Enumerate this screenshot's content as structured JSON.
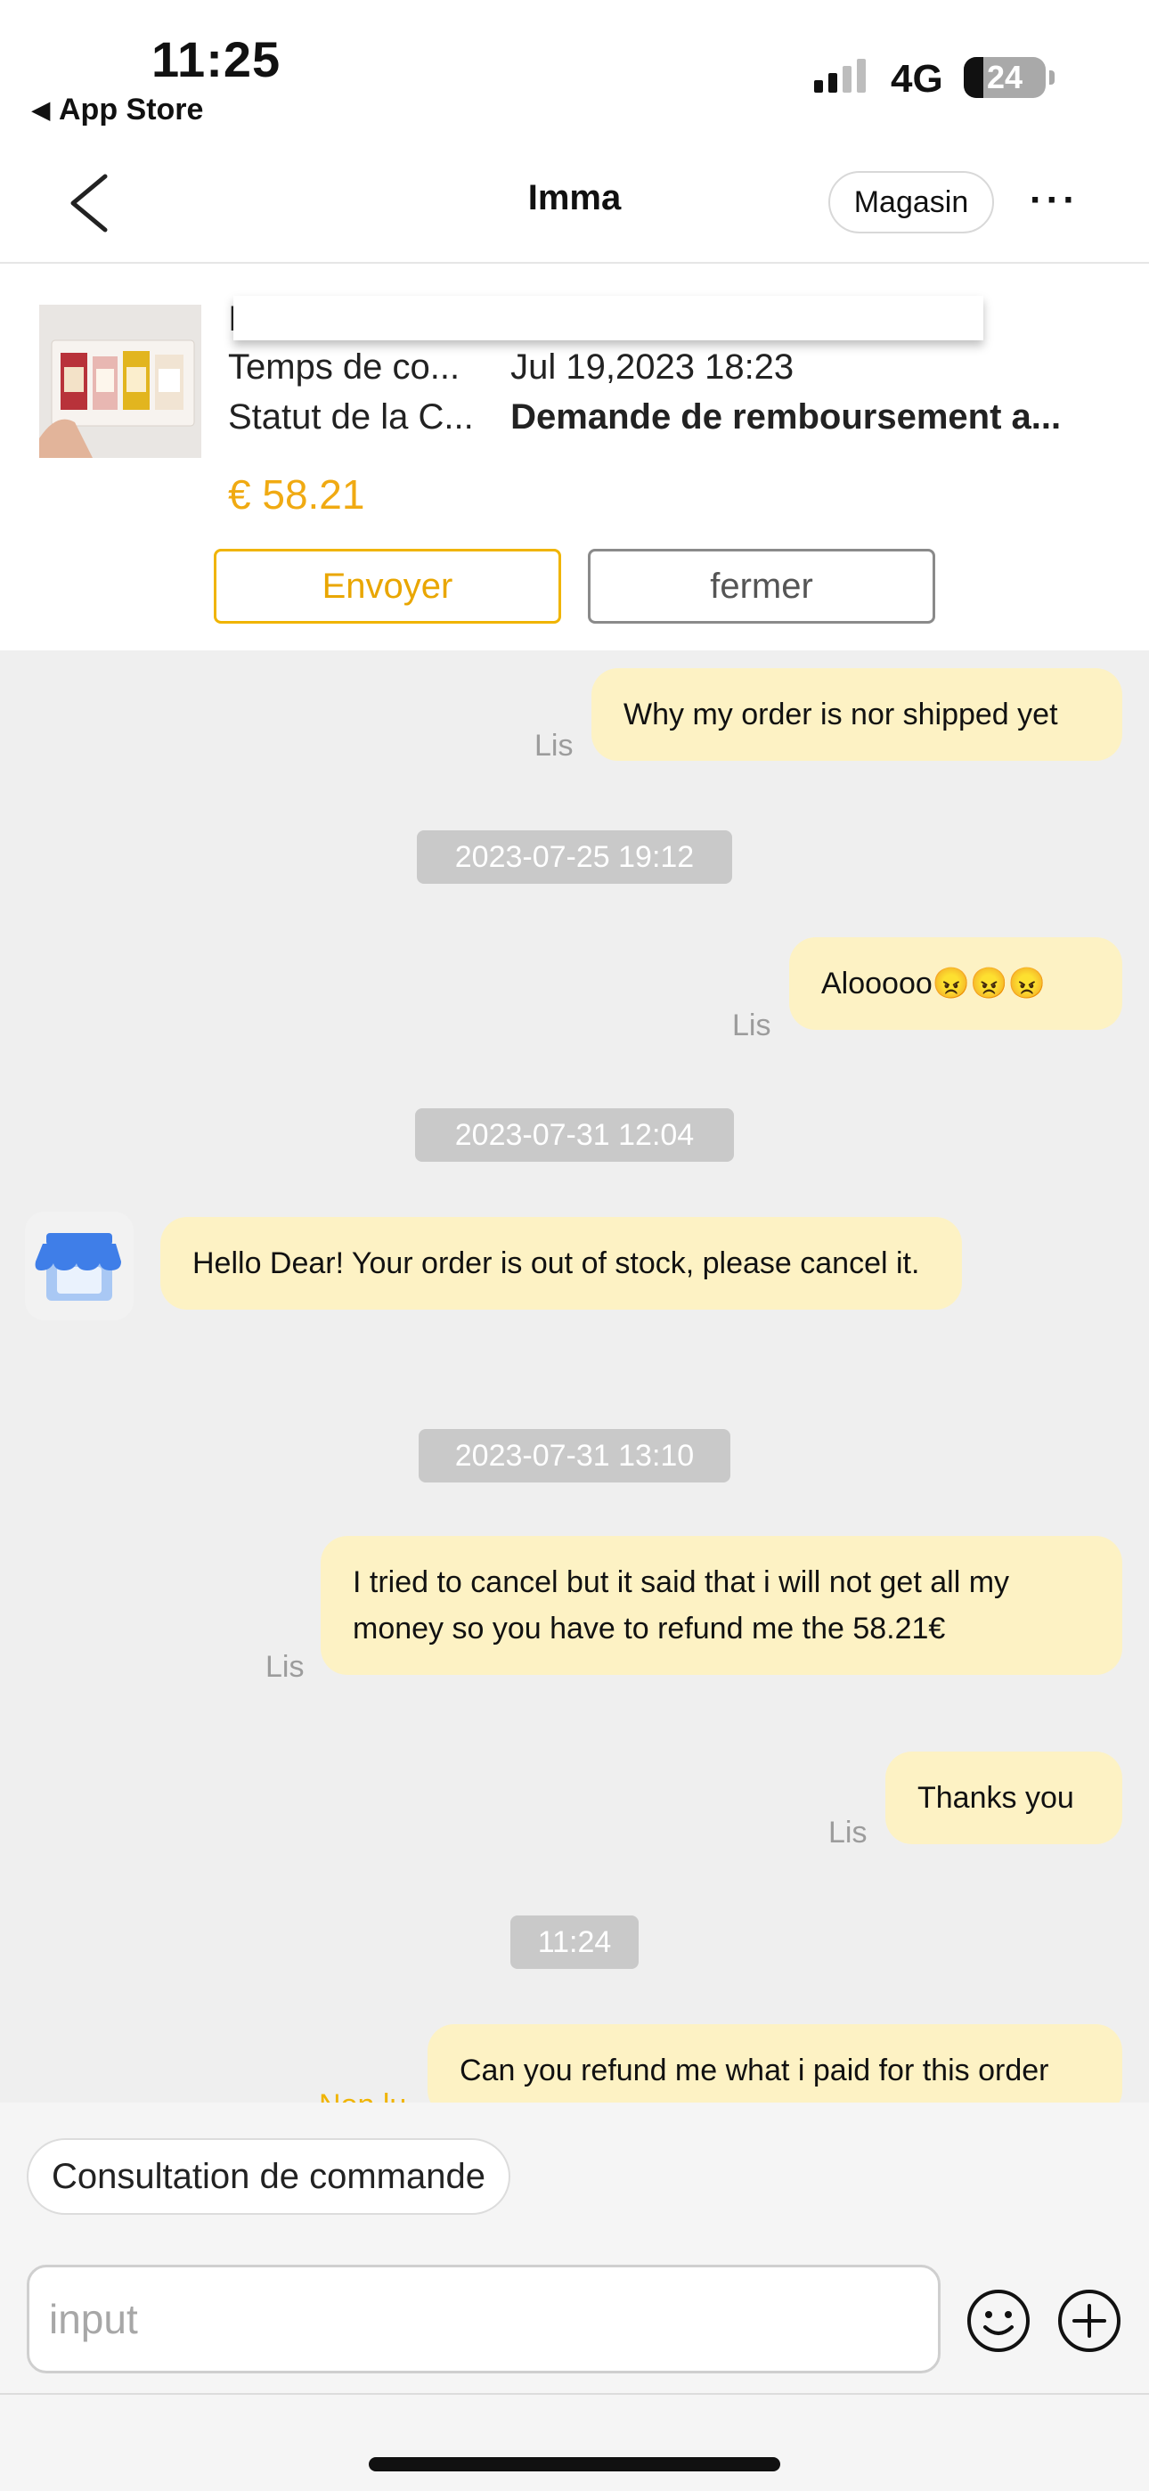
{
  "status_bar": {
    "time": "11:25",
    "back_app": "App Store",
    "network": "4G",
    "battery": "24"
  },
  "header": {
    "title": "Imma",
    "store_button": "Magasin",
    "more_icon": "more-dots-icon"
  },
  "order": {
    "truncated_line": "I",
    "time_label": "Temps de co...",
    "time_value": "Jul 19,2023 18:23",
    "status_label": "Statut de la C...",
    "status_value": "Demande de remboursement a...",
    "price": "€ 58.21",
    "send_button": "Envoyer",
    "close_button": "fermer"
  },
  "chat": {
    "messages": [
      {
        "type": "out",
        "sender": "Lis",
        "text": "Why my order is nor shipped yet"
      },
      {
        "type": "time",
        "text": "2023-07-25 19:12"
      },
      {
        "type": "out",
        "sender": "Lis",
        "text": "Alooooo😠😠😠"
      },
      {
        "type": "time",
        "text": "2023-07-31 12:04"
      },
      {
        "type": "in",
        "text": "Hello Dear! Your order is out of stock, please cancel it."
      },
      {
        "type": "time",
        "text": "2023-07-31 13:10"
      },
      {
        "type": "out",
        "sender": "Lis",
        "text": "I tried to cancel but it said that i will not get all my money so you have to refund me the 58.21€"
      },
      {
        "type": "out",
        "sender": "Lis",
        "text": "Thanks you"
      },
      {
        "type": "time",
        "text": "11:24"
      },
      {
        "type": "out",
        "sender": "Non lu",
        "text": "Can you refund me what i paid for this order"
      }
    ]
  },
  "footer": {
    "quick_reply": "Consultation de commande",
    "input_placeholder": "input"
  },
  "colors": {
    "bubble": "#fdf2c4",
    "accent": "#f0b400",
    "price": "#f0aa12"
  }
}
